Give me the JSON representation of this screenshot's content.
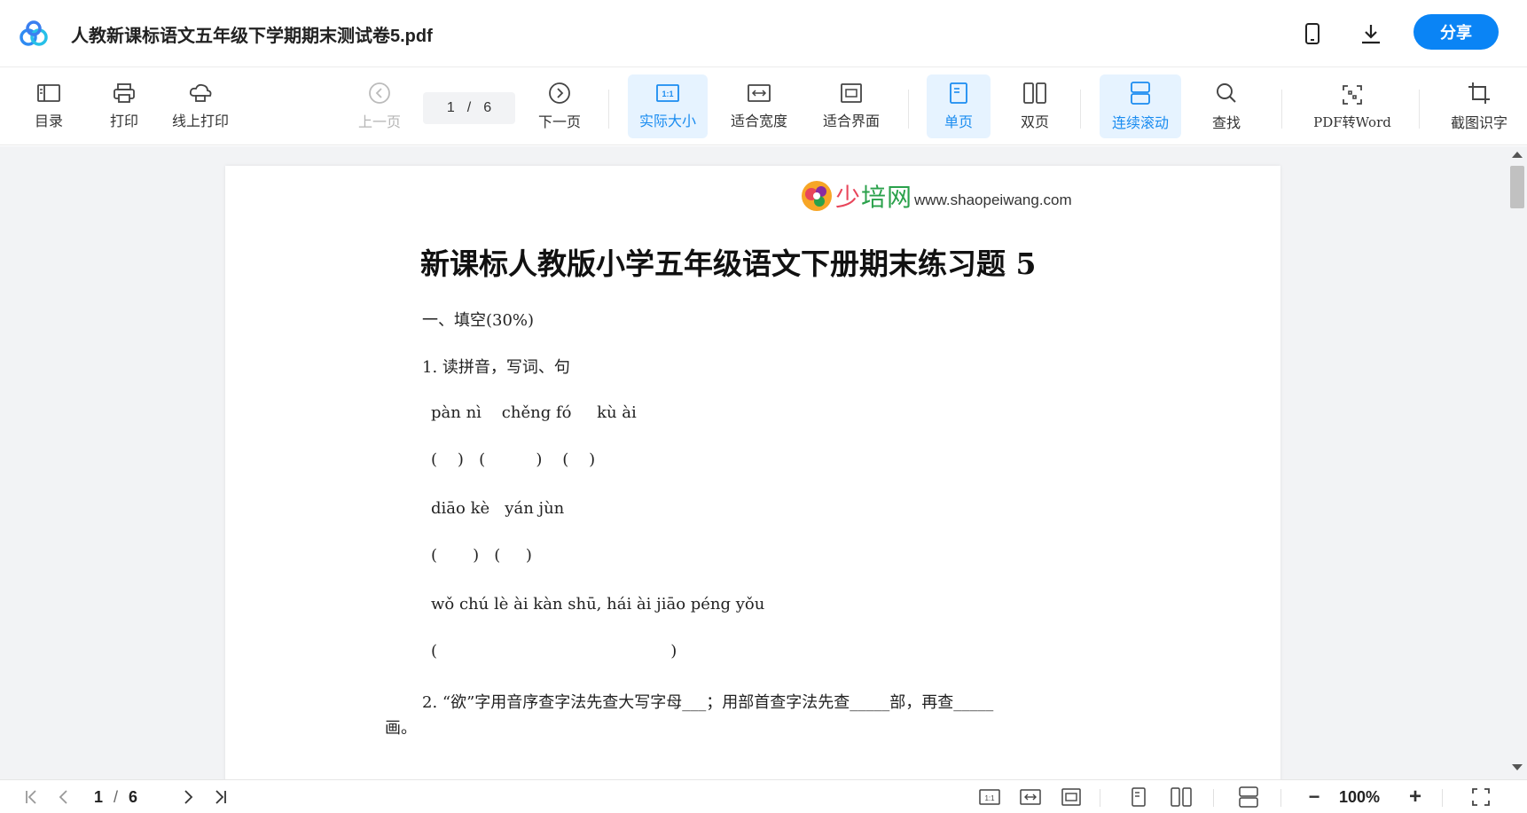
{
  "window": {
    "title": "人教新课标语文五年级下学期期末测试卷5.pdf",
    "share_label": "分享",
    "icons": [
      "app-logo-icon",
      "phone-icon",
      "download-icon"
    ]
  },
  "toolbar": {
    "toc": "目录",
    "print": "打印",
    "online_print": "线上打印",
    "prev_page": "上一页",
    "current_page": "1",
    "page_sep": "/",
    "total_pages": "6",
    "next_page": "下一页",
    "actual_size": "实际大小",
    "fit_width": "适合宽度",
    "fit_screen": "适合界面",
    "single_page": "单页",
    "double_page": "双页",
    "continuous_scroll": "连续滚动",
    "find": "查找",
    "pdf_to_word": "PDF转Word",
    "screenshot_ocr": "截图识字",
    "actual_size_icon_text": "1:1",
    "accent_color": "#1a8cf0",
    "active_bg": "#e6f3ff"
  },
  "document": {
    "logo_name_a": "少",
    "logo_name_b": "培网",
    "logo_url": "www.shaopeiwang.com",
    "heading": "新课标人教版小学五年级语文下册期末练习题 5",
    "lines": [
      "一、填空(30%)",
      "1. 读拼音，写词、句",
      "pàn nì    chěng fó     kù ài",
      "(    )   (          )    (    )",
      "diāo kè   yán jùn",
      "(       )   (     )",
      "wǒ chú lè ài kàn shū, hái ài jiāo péng yǒu",
      "(                                              )",
      "2. “欲”字用音序查字法先查大写字母___；用部首查字法先查_____部，再查_____",
      "画。"
    ]
  },
  "bottombar": {
    "current_page": "1",
    "page_sep": "/",
    "total_pages": "6",
    "zoom": "100%",
    "actual_size_icon_text": "1:1",
    "zoom_out": "−",
    "zoom_in": "+"
  }
}
